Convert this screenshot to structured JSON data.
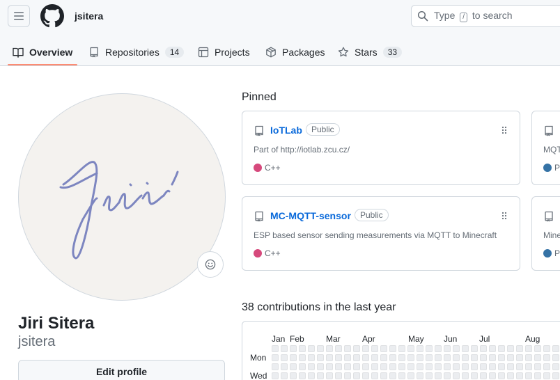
{
  "header": {
    "username": "jsitera",
    "search": {
      "prefix": "Type",
      "key": "/",
      "suffix": "to search"
    }
  },
  "tabs": [
    {
      "label": "Overview",
      "icon": "book-icon",
      "active": true
    },
    {
      "label": "Repositories",
      "icon": "repo-icon",
      "count": "14"
    },
    {
      "label": "Projects",
      "icon": "table-icon"
    },
    {
      "label": "Packages",
      "icon": "package-icon"
    },
    {
      "label": "Stars",
      "icon": "star-icon",
      "count": "33"
    }
  ],
  "profile": {
    "full_name": "Jiri Sitera",
    "login": "jsitera",
    "edit_label": "Edit profile",
    "avatar_signature": "Jiří"
  },
  "pinned": {
    "title": "Pinned",
    "cards": [
      {
        "name": "IoTLab",
        "visibility": "Public",
        "description": "Part of http://iotlab.zcu.cz/",
        "language": "C++",
        "language_color": "#f34b7d"
      },
      {
        "name": "MC-MQTT-sensor",
        "visibility": "Public",
        "description": "ESP based sensor sending measurements via MQTT to Minecraft",
        "language": "C++",
        "language_color": "#f34b7d"
      }
    ],
    "partial_cards": [
      {
        "description_fragment": "MQT",
        "language_fragment": "Py",
        "language_color": "#3572A5"
      },
      {
        "description_fragment": "Mine",
        "language_fragment": "Py",
        "language_color": "#3572A5"
      }
    ]
  },
  "contributions": {
    "title": "38 contributions in the last year",
    "months": [
      "Jan",
      "Feb",
      "Mar",
      "Apr",
      "May",
      "Jun",
      "Jul",
      "Aug"
    ],
    "day_labels": [
      "Mon",
      "Wed"
    ],
    "empty_color": "#ebedf0"
  },
  "colors": {
    "accent_link": "#0969da",
    "tab_underline": "#fd8c73",
    "border": "#d0d7de"
  }
}
